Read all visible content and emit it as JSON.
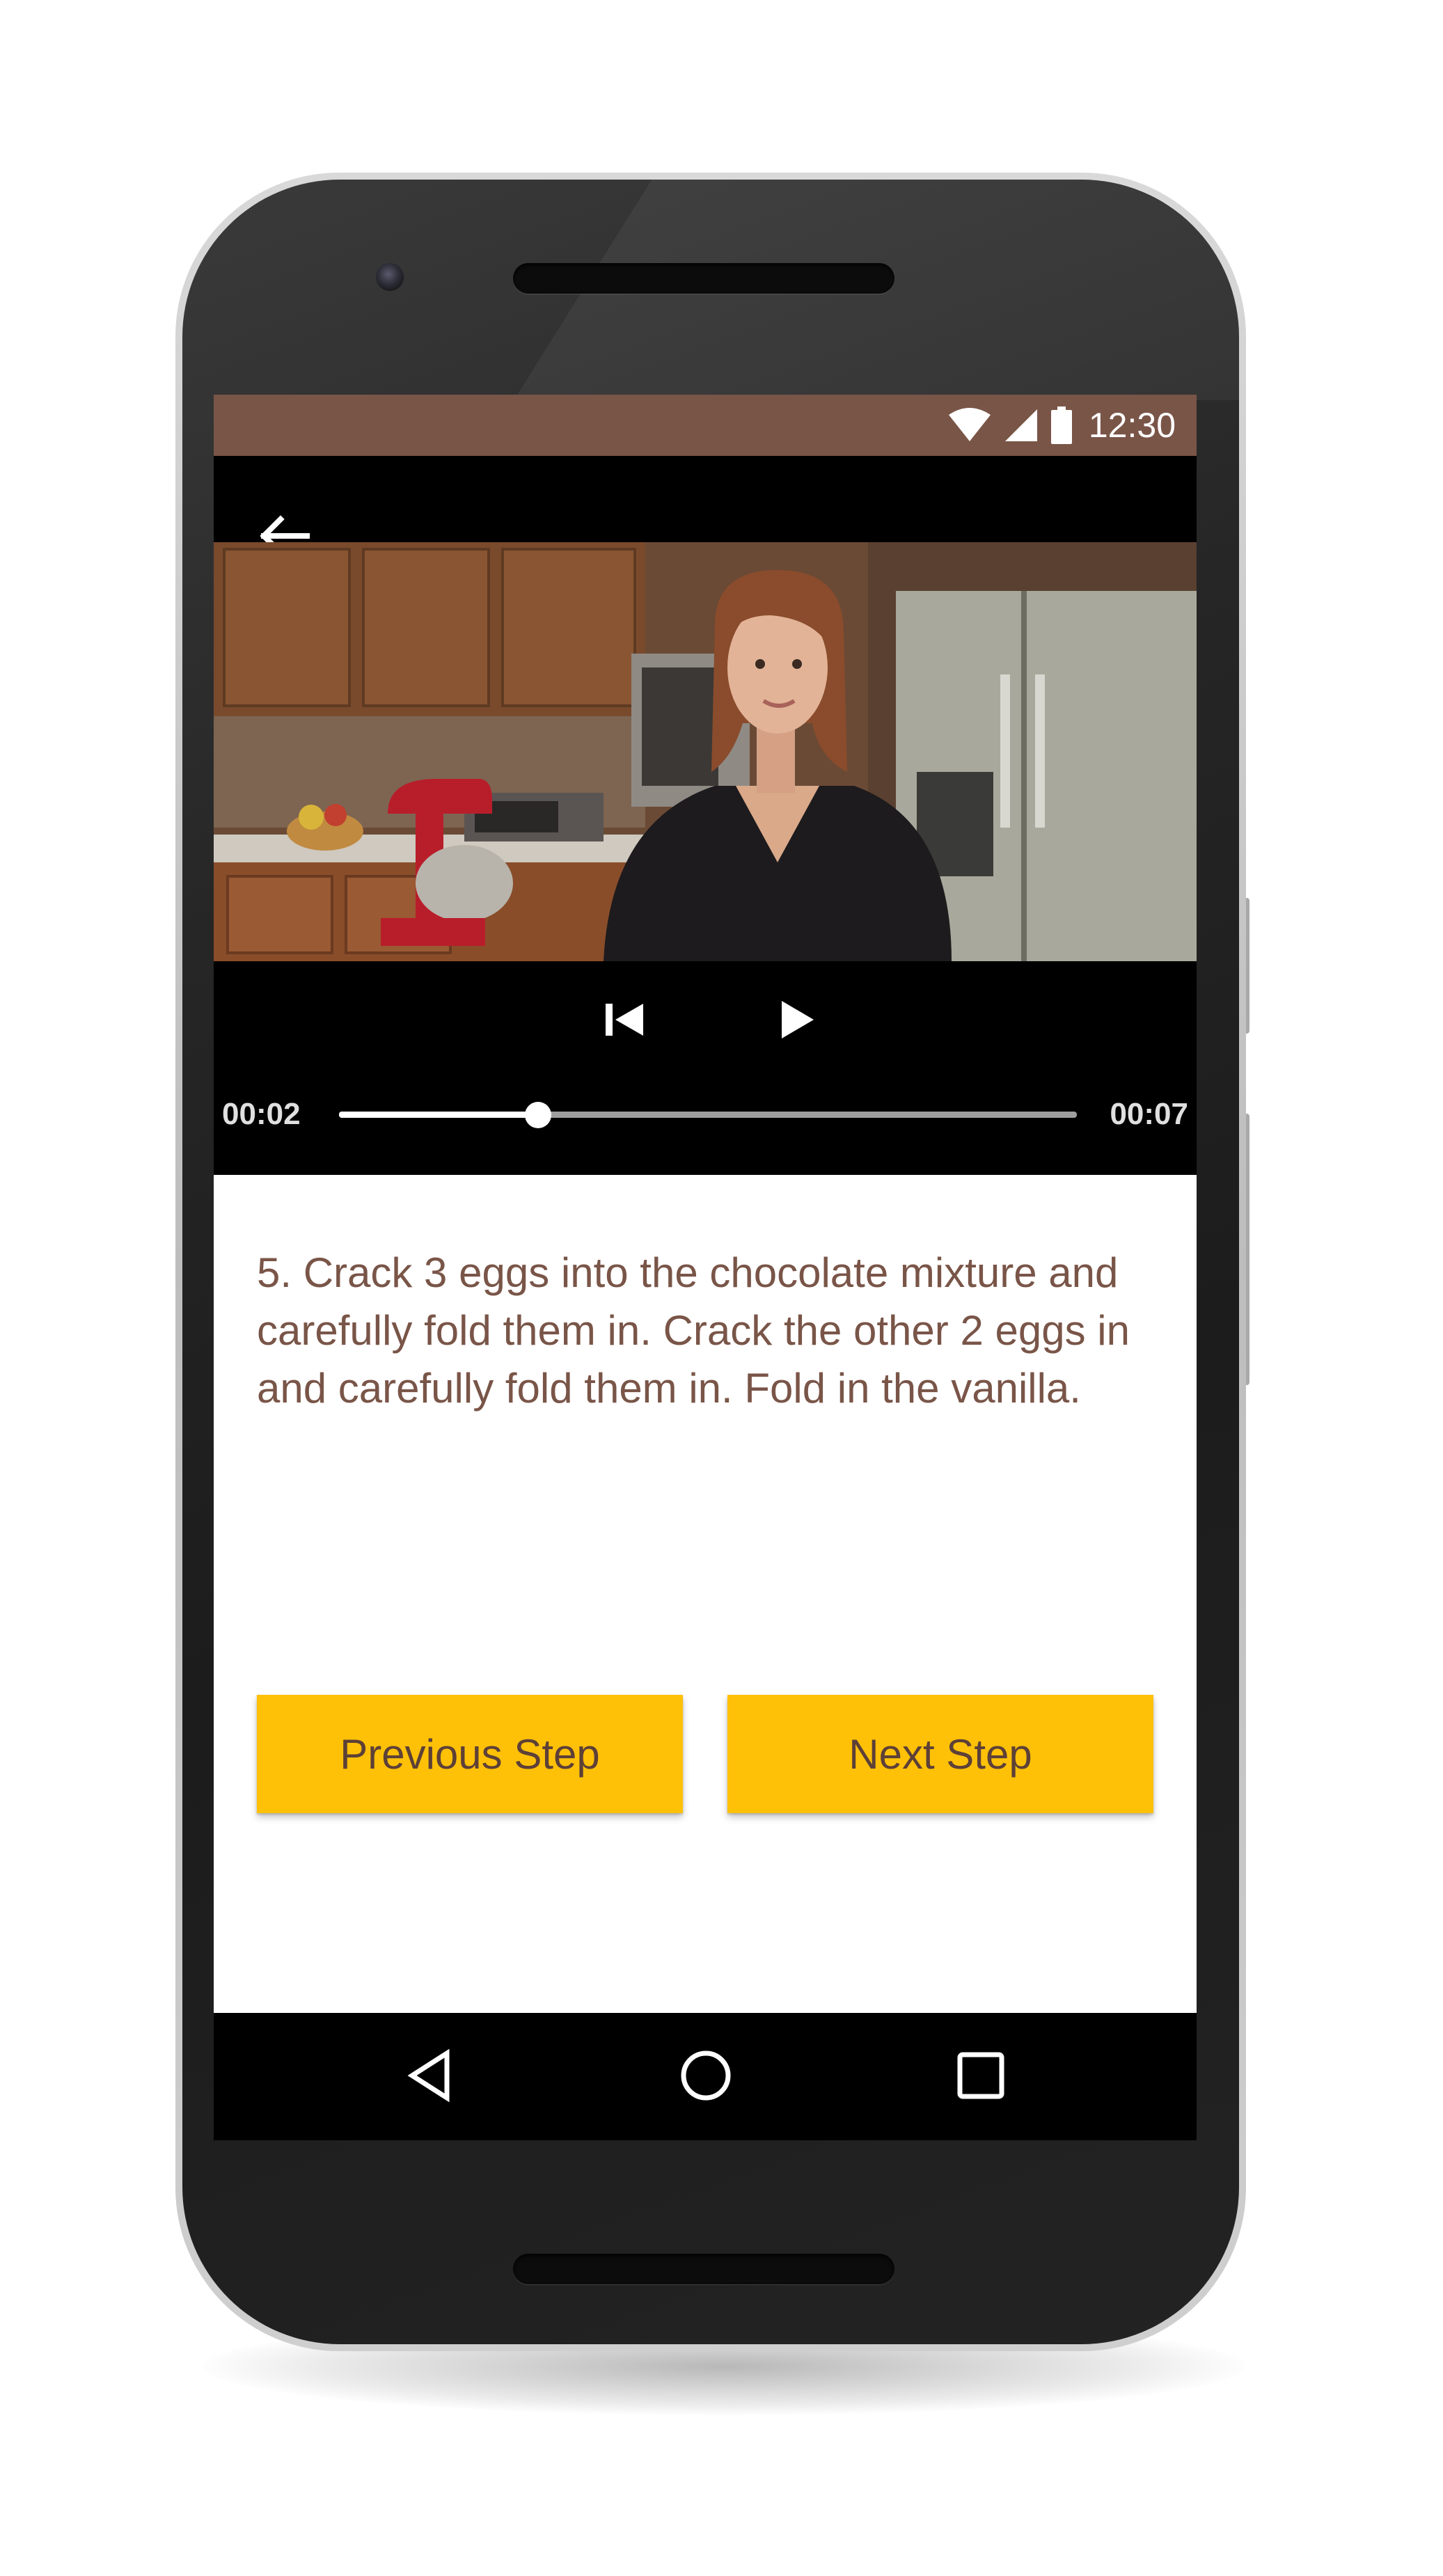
{
  "status_bar": {
    "time": "12:30",
    "icons": [
      "wifi-icon",
      "signal-icon",
      "battery-icon"
    ],
    "background": "#795548"
  },
  "video_player": {
    "back_icon": "arrow-back-icon",
    "controls": [
      "skip-previous-icon",
      "play-icon"
    ],
    "current_time": "00:02",
    "total_time": "00:07",
    "progress": 0.27
  },
  "step": {
    "description": "5. Crack 3 eggs into the chocolate mixture and carefully fold them in. Crack the other 2 eggs in and carefully fold them in. Fold in the vanilla.",
    "text_color": "#795548"
  },
  "buttons": {
    "previous_label": "Previous Step",
    "next_label": "Next Step",
    "color": "#ffc107",
    "text_color": "#5d4037"
  },
  "nav_bar": {
    "icons": [
      "nav-back-icon",
      "nav-home-icon",
      "nav-recents-icon"
    ]
  }
}
